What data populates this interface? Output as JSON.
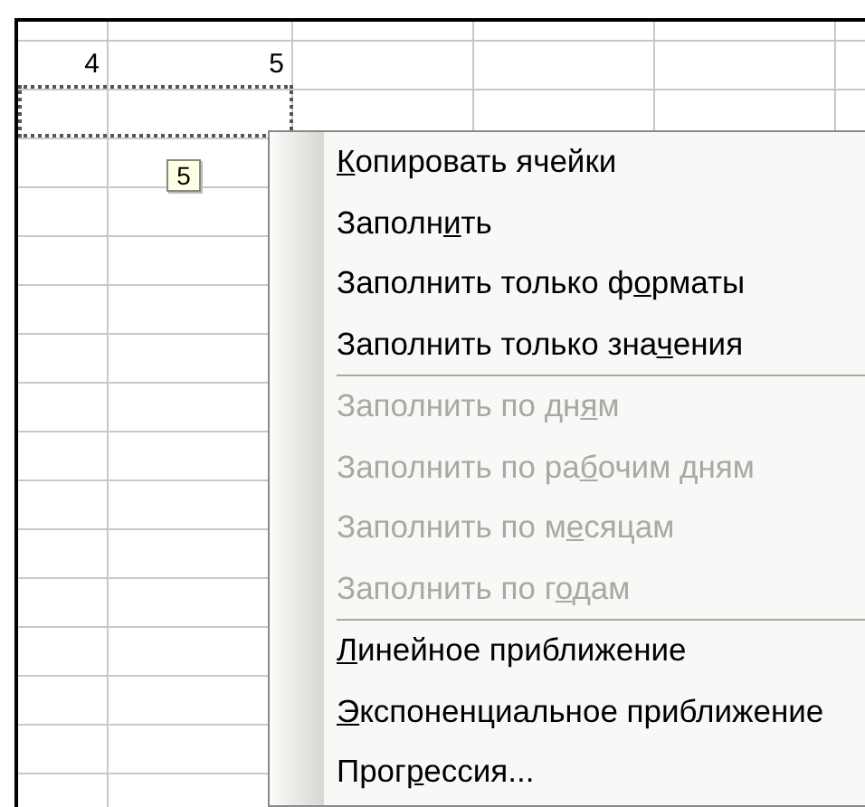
{
  "sheet": {
    "rows": [
      {
        "cells": [
          "",
          ""
        ]
      },
      {
        "cells": [
          "4",
          "5"
        ]
      },
      {
        "cells": [
          "",
          ""
        ],
        "selected": true
      },
      {
        "cells": [
          "",
          ""
        ]
      },
      {
        "cells": [
          "",
          ""
        ]
      },
      {
        "cells": [
          "",
          ""
        ]
      },
      {
        "cells": [
          "",
          ""
        ]
      },
      {
        "cells": [
          "",
          ""
        ]
      },
      {
        "cells": [
          "",
          ""
        ]
      },
      {
        "cells": [
          "",
          ""
        ]
      },
      {
        "cells": [
          "",
          ""
        ]
      },
      {
        "cells": [
          "",
          ""
        ]
      },
      {
        "cells": [
          "",
          ""
        ]
      },
      {
        "cells": [
          "",
          ""
        ]
      },
      {
        "cells": [
          "",
          ""
        ]
      },
      {
        "cells": [
          "",
          ""
        ]
      }
    ],
    "fill_tooltip": "5"
  },
  "context_menu": {
    "items": [
      {
        "kind": "item",
        "key": "К",
        "after": "опировать ячейки",
        "disabled": false
      },
      {
        "kind": "item",
        "before": "Заполн",
        "key": "и",
        "after": "ть",
        "disabled": false
      },
      {
        "kind": "item",
        "before": "Заполнить только ф",
        "key": "о",
        "after": "рматы",
        "disabled": false
      },
      {
        "kind": "item",
        "before": "Заполнить только зна",
        "key": "ч",
        "after": "ения",
        "disabled": false
      },
      {
        "kind": "separator"
      },
      {
        "kind": "item",
        "before": "Заполнить по дн",
        "key": "я",
        "after": "м",
        "disabled": true
      },
      {
        "kind": "item",
        "before": "Заполнить по ра",
        "key": "б",
        "after": "очим дням",
        "disabled": true
      },
      {
        "kind": "item",
        "before": "Заполнить по м",
        "key": "е",
        "after": "сяцам",
        "disabled": true
      },
      {
        "kind": "item",
        "before": "Заполнить по г",
        "key": "о",
        "after": "дам",
        "disabled": true
      },
      {
        "kind": "separator"
      },
      {
        "kind": "item",
        "key": "Л",
        "after": "инейное приближение",
        "disabled": false
      },
      {
        "kind": "item",
        "key": "Э",
        "after": "кспоненциальное приближение",
        "disabled": false
      },
      {
        "kind": "item",
        "before": "Прог",
        "key": "р",
        "after": "ессия...",
        "disabled": false
      }
    ]
  }
}
